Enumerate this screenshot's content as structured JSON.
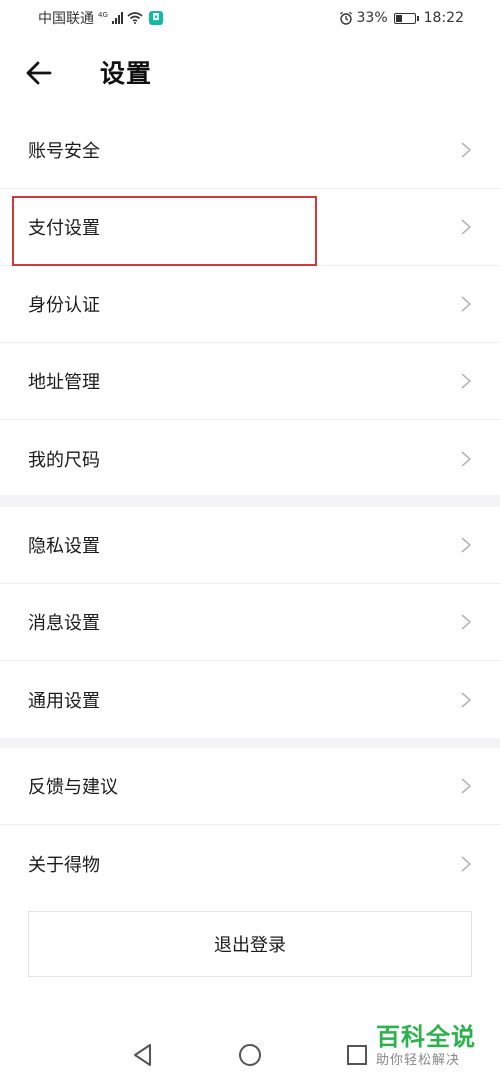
{
  "status_bar": {
    "carrier": "中国联通",
    "network": "4G",
    "battery_percent": "33%",
    "battery_level": 0.33,
    "time": "18:22",
    "alarm_icon": "alarm-clock-icon"
  },
  "header": {
    "title": "设置",
    "back_icon": "arrow-left-icon"
  },
  "groups": [
    {
      "items": [
        "账号安全",
        "支付设置",
        "身份认证",
        "地址管理",
        "我的尺码"
      ]
    },
    {
      "items": [
        "隐私设置",
        "消息设置",
        "通用设置"
      ]
    },
    {
      "items": [
        "反馈与建议",
        "关于得物"
      ]
    }
  ],
  "logout": {
    "label": "退出登录"
  },
  "nav": {
    "icons": [
      "triangle-back-icon",
      "circle-home-icon",
      "square-recent-icon"
    ]
  },
  "watermark": {
    "title": "百科全说",
    "subtitle": "助你轻松解决"
  },
  "colors": {
    "highlight": "#cf3b3b",
    "watermark": "#2bb24c",
    "divider": "#f4f4f7"
  }
}
